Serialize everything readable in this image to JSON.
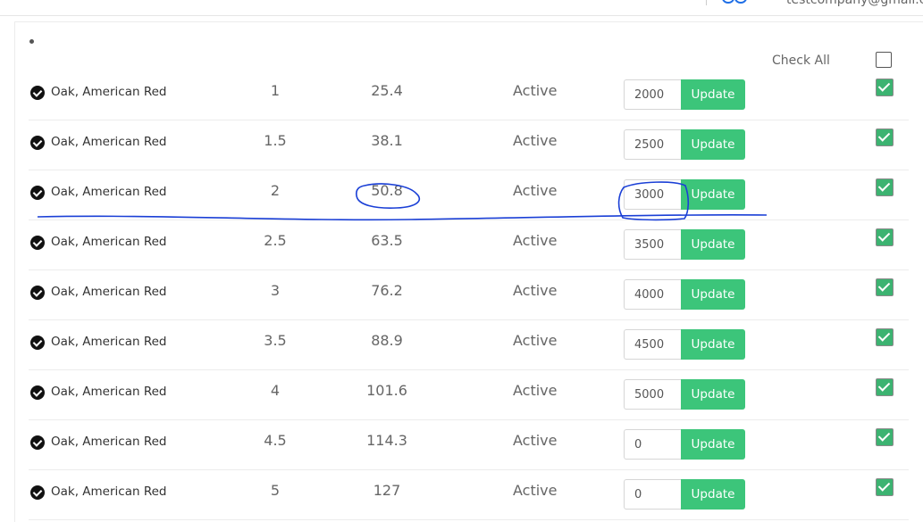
{
  "header": {
    "user_email": "testcompany@gmail.com"
  },
  "table": {
    "check_all_label": "Check All",
    "check_all_checked": false,
    "update_label": "Update",
    "rows": [
      {
        "name": "Oak, American Red",
        "inch": "1",
        "mm": "25.4",
        "status": "Active",
        "price": "2000",
        "selected": true
      },
      {
        "name": "Oak, American Red",
        "inch": "1.5",
        "mm": "38.1",
        "status": "Active",
        "price": "2500",
        "selected": true
      },
      {
        "name": "Oak, American Red",
        "inch": "2",
        "mm": "50.8",
        "status": "Active",
        "price": "3000",
        "selected": true
      },
      {
        "name": "Oak, American Red",
        "inch": "2.5",
        "mm": "63.5",
        "status": "Active",
        "price": "3500",
        "selected": true
      },
      {
        "name": "Oak, American Red",
        "inch": "3",
        "mm": "76.2",
        "status": "Active",
        "price": "4000",
        "selected": true
      },
      {
        "name": "Oak, American Red",
        "inch": "3.5",
        "mm": "88.9",
        "status": "Active",
        "price": "4500",
        "selected": true
      },
      {
        "name": "Oak, American Red",
        "inch": "4",
        "mm": "101.6",
        "status": "Active",
        "price": "5000",
        "selected": true
      },
      {
        "name": "Oak, American Red",
        "inch": "4.5",
        "mm": "114.3",
        "status": "Active",
        "price": "0",
        "selected": true
      },
      {
        "name": "Oak, American Red",
        "inch": "5",
        "mm": "127",
        "status": "Active",
        "price": "0",
        "selected": true
      }
    ]
  },
  "colors": {
    "update_button": "#3cc57a",
    "checkbox_checked": "#3cb371",
    "annotation_pen": "#1a3fd6"
  }
}
